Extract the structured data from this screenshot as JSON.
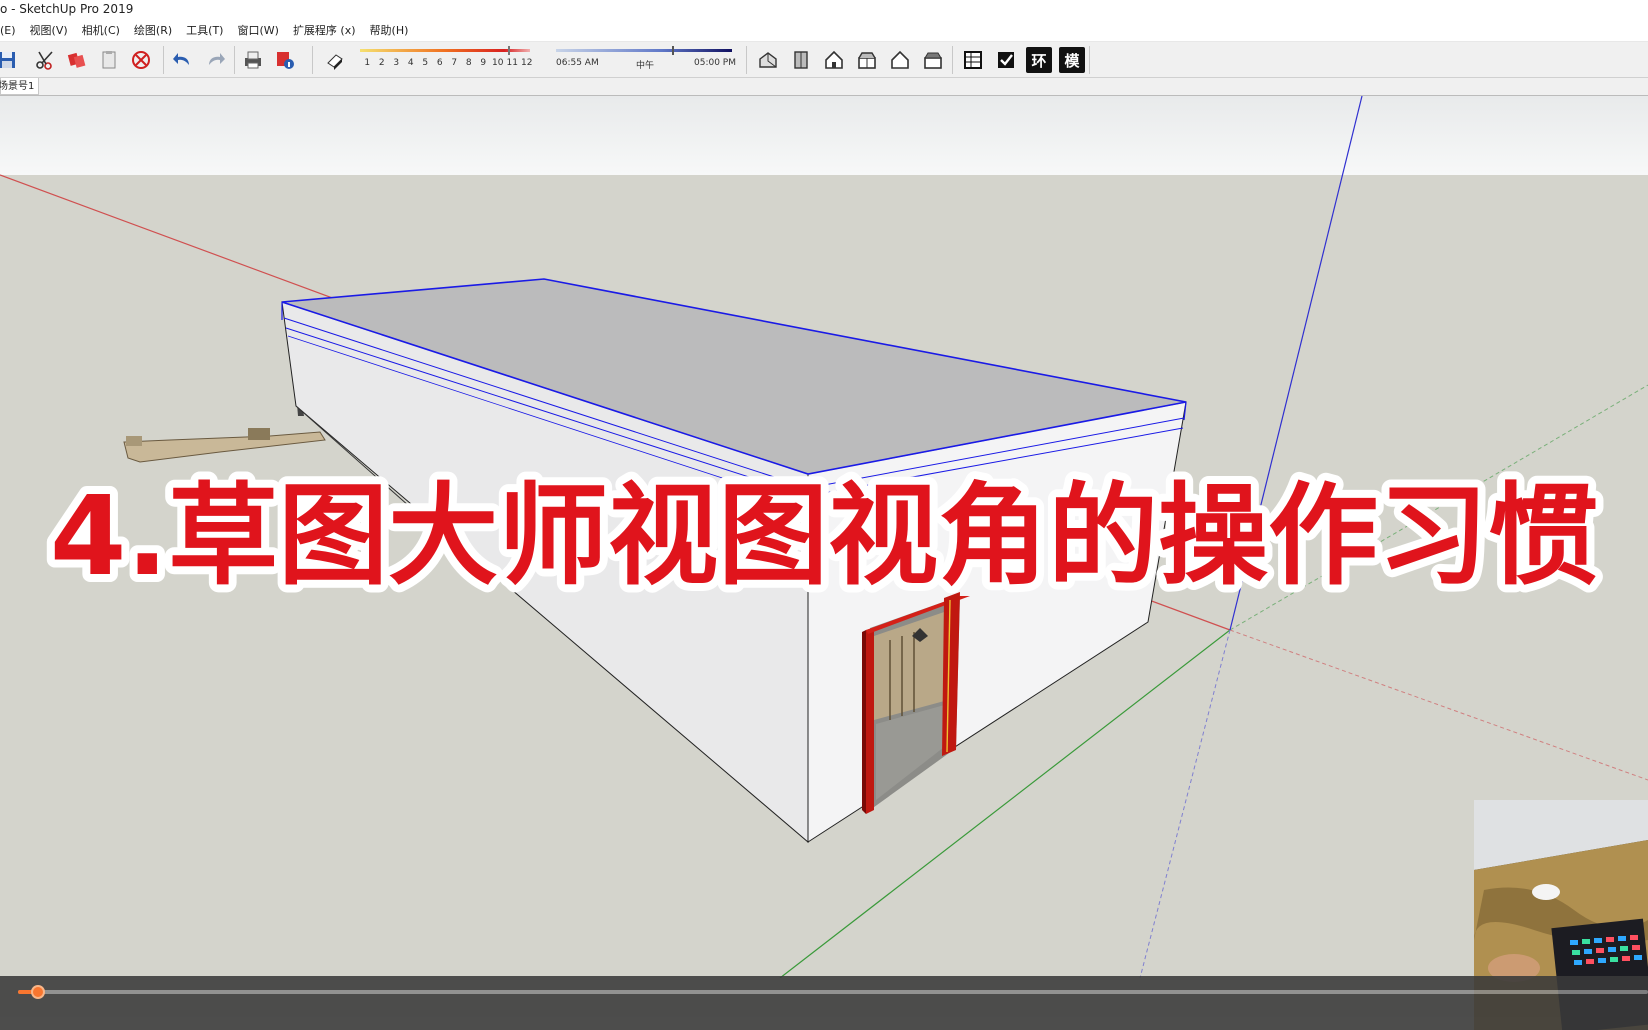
{
  "window": {
    "title": "o - SketchUp Pro 2019"
  },
  "menu": {
    "items": [
      "(E)",
      "视图(V)",
      "相机(C)",
      "绘图(R)",
      "工具(T)",
      "窗口(W)",
      "扩展程序 (x)",
      "帮助(H)"
    ]
  },
  "toolbar": {
    "icons": [
      "save-icon",
      "cut-icon",
      "copy-icon",
      "paste-icon",
      "erase-icon",
      "undo-icon",
      "redo-icon",
      "print-icon",
      "model-info-icon",
      "shadow-toggle-icon",
      "iso-view-icon",
      "top-view-icon",
      "front-view-icon",
      "right-view-icon",
      "back-view-icon",
      "left-view-icon",
      "table-icon",
      "checkbox-icon",
      "environment-icon",
      "model-icon"
    ],
    "month_ticks": [
      "1",
      "2",
      "3",
      "4",
      "5",
      "6",
      "7",
      "8",
      "9",
      "10",
      "11",
      "12"
    ],
    "time_start": "06:55 AM",
    "time_mid": "中午",
    "time_end": "05:00 PM",
    "env_label": "环",
    "model_label": "模"
  },
  "scenes": {
    "tab_label": "场景号1"
  },
  "overlay": {
    "title": "4.草图大师视图视角的操作习惯",
    "fill_color": "#e0141c",
    "outline_color": "#ffffff"
  },
  "player": {
    "progress": 0.012,
    "accent_color": "#ff6a1a"
  },
  "colors": {
    "viewport_ground": "#d4d4cc",
    "sky_top": "#f4f6f7",
    "selection_blue": "#1a1ae6",
    "axis_red": "#d04040",
    "axis_green": "#3a9a3a",
    "axis_blue": "#3030d0"
  }
}
